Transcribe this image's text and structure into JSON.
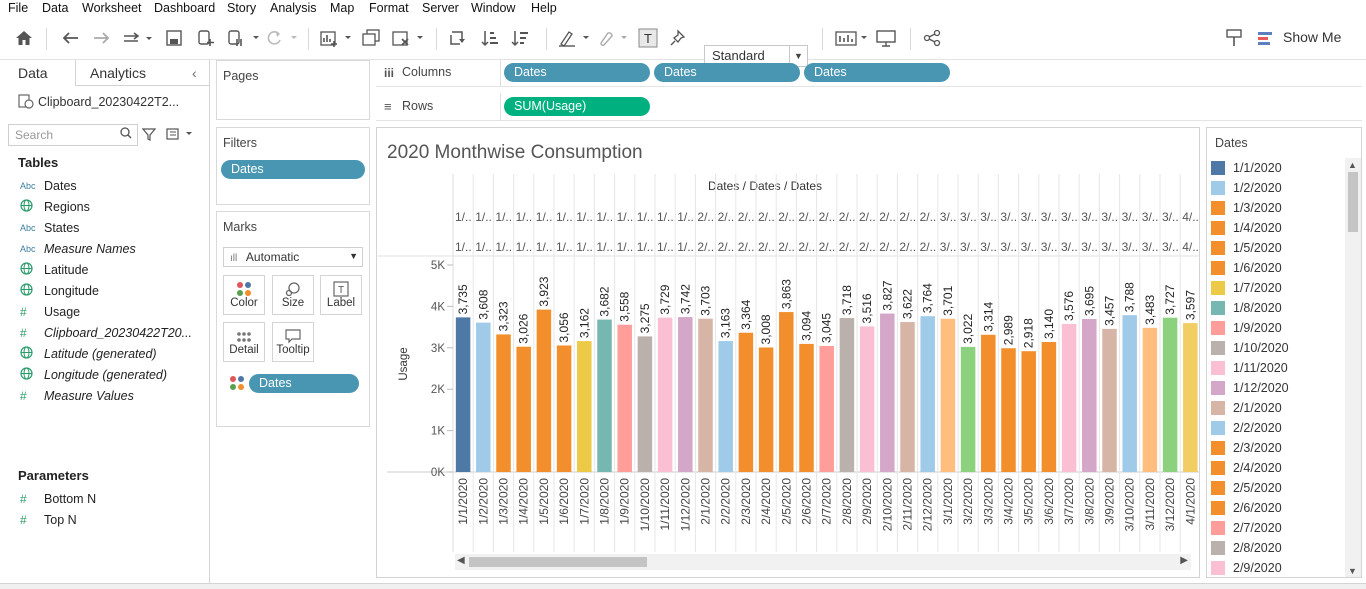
{
  "menu": [
    "File",
    "Data",
    "Worksheet",
    "Dashboard",
    "Story",
    "Analysis",
    "Map",
    "Format",
    "Server",
    "Window",
    "Help"
  ],
  "toolbar": {
    "fit_dropdown": "Standard",
    "show_me": "Show Me"
  },
  "datapanel": {
    "tabs": [
      "Data",
      "Analytics"
    ],
    "datasource": "Clipboard_20230422T2...",
    "search_placeholder": "Search",
    "tables_heading": "Tables",
    "fields": [
      {
        "icon": "Abc",
        "name": "Dates",
        "italic": false
      },
      {
        "icon": "globe",
        "name": "Regions",
        "italic": false
      },
      {
        "icon": "Abc",
        "name": "States",
        "italic": false
      },
      {
        "icon": "Abc",
        "name": "Measure Names",
        "italic": true
      },
      {
        "icon": "globe",
        "name": "Latitude",
        "italic": false
      },
      {
        "icon": "globe",
        "name": "Longitude",
        "italic": false
      },
      {
        "icon": "#",
        "name": "Usage",
        "italic": false
      },
      {
        "icon": "#",
        "name": "Clipboard_20230422T20...",
        "italic": true
      },
      {
        "icon": "globe",
        "name": "Latitude (generated)",
        "italic": true
      },
      {
        "icon": "globe",
        "name": "Longitude (generated)",
        "italic": true
      },
      {
        "icon": "#",
        "name": "Measure Values",
        "italic": true
      }
    ],
    "parameters_heading": "Parameters",
    "parameters": [
      "Bottom N",
      "Top N"
    ]
  },
  "pages": {
    "title": "Pages"
  },
  "filters": {
    "title": "Filters",
    "pills": [
      "Dates"
    ]
  },
  "marks": {
    "title": "Marks",
    "type": "Automatic",
    "buttons": [
      "Color",
      "Size",
      "Label",
      "Detail",
      "Tooltip"
    ],
    "color_pill": "Dates"
  },
  "shelves": {
    "columns_label": "Columns",
    "columns": [
      "Dates",
      "Dates",
      "Dates"
    ],
    "rows_label": "Rows",
    "rows": [
      "SUM(Usage)"
    ]
  },
  "view": {
    "title": "2020 Monthwise Consumption"
  },
  "chart_data": {
    "type": "bar",
    "title": "2020 Monthwise Consumption",
    "header": "Dates / Dates / Dates",
    "ylabel": "Usage",
    "yticks": [
      "0K",
      "1K",
      "2K",
      "3K",
      "4K",
      "5K"
    ],
    "ylim": [
      0,
      5000
    ],
    "categories": [
      "1/1/2020",
      "1/2/2020",
      "1/3/2020",
      "1/4/2020",
      "1/5/2020",
      "1/6/2020",
      "1/7/2020",
      "1/8/2020",
      "1/9/2020",
      "1/10/2020",
      "1/11/2020",
      "1/12/2020",
      "2/1/2020",
      "2/2/2020",
      "2/3/2020",
      "2/4/2020",
      "2/5/2020",
      "2/6/2020",
      "2/7/2020",
      "2/8/2020",
      "2/9/2020",
      "2/10/2020",
      "2/11/2020",
      "2/12/2020",
      "3/1/2020",
      "3/2/2020",
      "3/3/2020",
      "3/4/2020",
      "3/5/2020",
      "3/6/2020",
      "3/7/2020",
      "3/8/2020",
      "3/9/2020",
      "3/10/2020",
      "3/11/2020",
      "3/12/2020",
      "4/1/2020"
    ],
    "header_abbrev": [
      "1/..",
      "1/..",
      "1/..",
      "1/..",
      "1/..",
      "1/..",
      "1/..",
      "1/..",
      "1/..",
      "1/..",
      "1/..",
      "1/..",
      "2/..",
      "2/..",
      "2/..",
      "2/..",
      "2/..",
      "2/..",
      "2/..",
      "2/..",
      "2/..",
      "2/..",
      "2/..",
      "2/..",
      "3/..",
      "3/..",
      "3/..",
      "3/..",
      "3/..",
      "3/..",
      "3/..",
      "3/..",
      "3/..",
      "3/..",
      "3/..",
      "3/..",
      "4/.."
    ],
    "values": [
      3735,
      3608,
      3323,
      3026,
      3923,
      3056,
      3162,
      3682,
      3558,
      3275,
      3729,
      3742,
      3703,
      3163,
      3364,
      3008,
      3863,
      3094,
      3045,
      3718,
      3516,
      3827,
      3622,
      3764,
      3701,
      3022,
      3314,
      2989,
      2918,
      3140,
      3576,
      3695,
      3457,
      3788,
      3483,
      3727,
      3597
    ],
    "labels": [
      "3,735",
      "3,608",
      "3,323",
      "3,026",
      "3,923",
      "3,056",
      "3,162",
      "3,682",
      "3,558",
      "3,275",
      "3,729",
      "3,742",
      "3,703",
      "3,163",
      "3,364",
      "3,008",
      "3,863",
      "3,094",
      "3,045",
      "3,718",
      "3,516",
      "3,827",
      "3,622",
      "3,764",
      "3,701",
      "3,022",
      "3,314",
      "2,989",
      "2,918",
      "3,140",
      "3,576",
      "3,695",
      "3,457",
      "3,788",
      "3,483",
      "3,727",
      "3,597"
    ],
    "colors": [
      "#4e79a7",
      "#a0cbe8",
      "#f28e2b",
      "#f28e2b",
      "#f28e2b",
      "#f28e2b",
      "#edc948",
      "#76b7b2",
      "#ff9d9a",
      "#bab0ac",
      "#fabfd2",
      "#d4a6c8",
      "#d7b5a6",
      "#a0cbe8",
      "#f28e2b",
      "#f28e2b",
      "#f28e2b",
      "#f28e2b",
      "#ff9d9a",
      "#bab0ac",
      "#fabfd2",
      "#d4a6c8",
      "#d7b5a6",
      "#a0cbe8",
      "#ffbe7d",
      "#8cd17d",
      "#f28e2b",
      "#f28e2b",
      "#f28e2b",
      "#f28e2b",
      "#fabfd2",
      "#d4a6c8",
      "#d7b5a6",
      "#a0cbe8",
      "#ffbe7d",
      "#8cd17d",
      "#f1ce63"
    ],
    "grid": false,
    "legend": "right"
  },
  "legend": {
    "title": "Dates",
    "items": [
      {
        "label": "1/1/2020",
        "color": "#4e79a7"
      },
      {
        "label": "1/2/2020",
        "color": "#a0cbe8"
      },
      {
        "label": "1/3/2020",
        "color": "#f28e2b"
      },
      {
        "label": "1/4/2020",
        "color": "#f28e2b"
      },
      {
        "label": "1/5/2020",
        "color": "#f28e2b"
      },
      {
        "label": "1/6/2020",
        "color": "#f28e2b"
      },
      {
        "label": "1/7/2020",
        "color": "#edc948"
      },
      {
        "label": "1/8/2020",
        "color": "#76b7b2"
      },
      {
        "label": "1/9/2020",
        "color": "#ff9d9a"
      },
      {
        "label": "1/10/2020",
        "color": "#bab0ac"
      },
      {
        "label": "1/11/2020",
        "color": "#fabfd2"
      },
      {
        "label": "1/12/2020",
        "color": "#d4a6c8"
      },
      {
        "label": "2/1/2020",
        "color": "#d7b5a6"
      },
      {
        "label": "2/2/2020",
        "color": "#a0cbe8"
      },
      {
        "label": "2/3/2020",
        "color": "#f28e2b"
      },
      {
        "label": "2/4/2020",
        "color": "#f28e2b"
      },
      {
        "label": "2/5/2020",
        "color": "#f28e2b"
      },
      {
        "label": "2/6/2020",
        "color": "#f28e2b"
      },
      {
        "label": "2/7/2020",
        "color": "#ff9d9a"
      },
      {
        "label": "2/8/2020",
        "color": "#bab0ac"
      },
      {
        "label": "2/9/2020",
        "color": "#fabfd2"
      }
    ]
  }
}
